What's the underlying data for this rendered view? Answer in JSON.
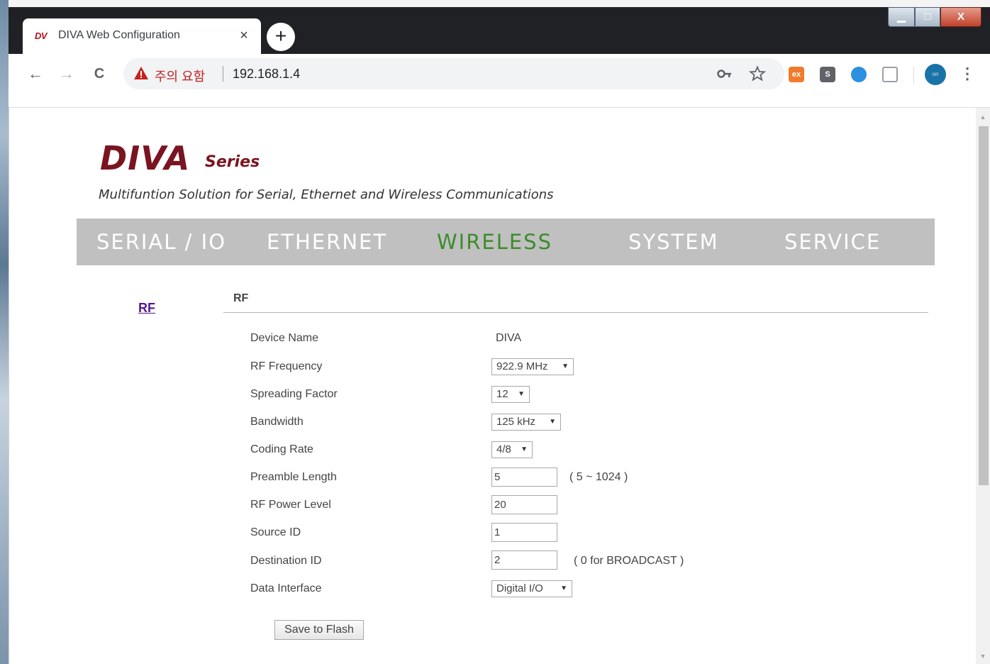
{
  "browser": {
    "tab_favicon": "DV",
    "tab_title": "DIVA Web Configuration",
    "tab_close": "×",
    "new_tab": "+",
    "security_warning": "주의 요함",
    "url": "192.168.1.4",
    "window_controls": {
      "minimize": "▁",
      "maximize": "□",
      "close": "X"
    },
    "nav": {
      "back": "←",
      "forward": "→",
      "reload": "C"
    },
    "extensions": [
      "ex",
      "S",
      "",
      ""
    ],
    "profile": "on"
  },
  "page": {
    "logo_main": "DIVA",
    "logo_sub": "Series",
    "tagline": "Multifuntion Solution for Serial, Ethernet and Wireless Communications",
    "menu": {
      "serial": "SERIAL / IO",
      "ethernet": "ETHERNET",
      "wireless": "WIRELESS",
      "system": "SYSTEM",
      "service": "SERVICE"
    },
    "active_menu": "WIRELESS",
    "active_color": "#3c8c2c",
    "side_link": "RF",
    "section_title": "RF",
    "form": {
      "device_name_label": "Device Name",
      "device_name_value": "DIVA",
      "rf_frequency_label": "RF Frequency",
      "rf_frequency_value": "922.9 MHz",
      "spreading_factor_label": "Spreading Factor",
      "spreading_factor_value": "12",
      "bandwidth_label": "Bandwidth",
      "bandwidth_value": "125 kHz",
      "coding_rate_label": "Coding Rate",
      "coding_rate_value": "4/8",
      "preamble_length_label": "Preamble Length",
      "preamble_length_value": "5",
      "preamble_length_hint": "( 5 ~ 1024 )",
      "rf_power_level_label": "RF Power Level",
      "rf_power_level_value": "20",
      "source_id_label": "Source ID",
      "source_id_value": "1",
      "destination_id_label": "Destination ID",
      "destination_id_value": "2",
      "destination_id_hint": "( 0 for BROADCAST )",
      "data_interface_label": "Data Interface",
      "data_interface_value": "Digital I/O",
      "save_button": "Save to Flash"
    }
  }
}
